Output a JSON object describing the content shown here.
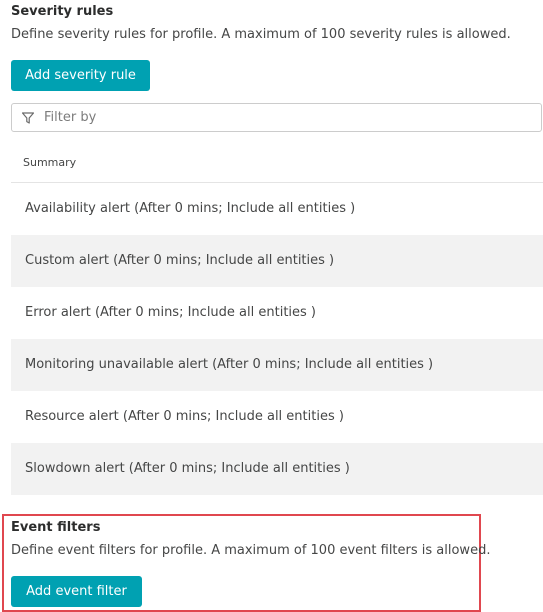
{
  "severity": {
    "title": "Severity rules",
    "description": "Define severity rules for profile. A maximum of 100 severity rules is allowed.",
    "add_button": "Add severity rule",
    "filter_placeholder": "Filter by",
    "column_header": "Summary",
    "rows": [
      "Availability alert (After 0 mins; Include all entities )",
      "Custom alert (After 0 mins; Include all entities )",
      "Error alert (After 0 mins; Include all entities )",
      "Monitoring unavailable alert (After 0 mins; Include all entities )",
      "Resource alert (After 0 mins; Include all entities )",
      "Slowdown alert (After 0 mins; Include all entities )"
    ]
  },
  "event_filters": {
    "title": "Event filters",
    "description": "Define event filters for profile. A maximum of 100 event filters is allowed.",
    "add_button": "Add event filter"
  },
  "icons": {
    "filter": "filter-icon"
  },
  "colors": {
    "accent": "#00a1b2",
    "highlight_border": "#e0474f",
    "row_alt": "#f2f2f2"
  }
}
